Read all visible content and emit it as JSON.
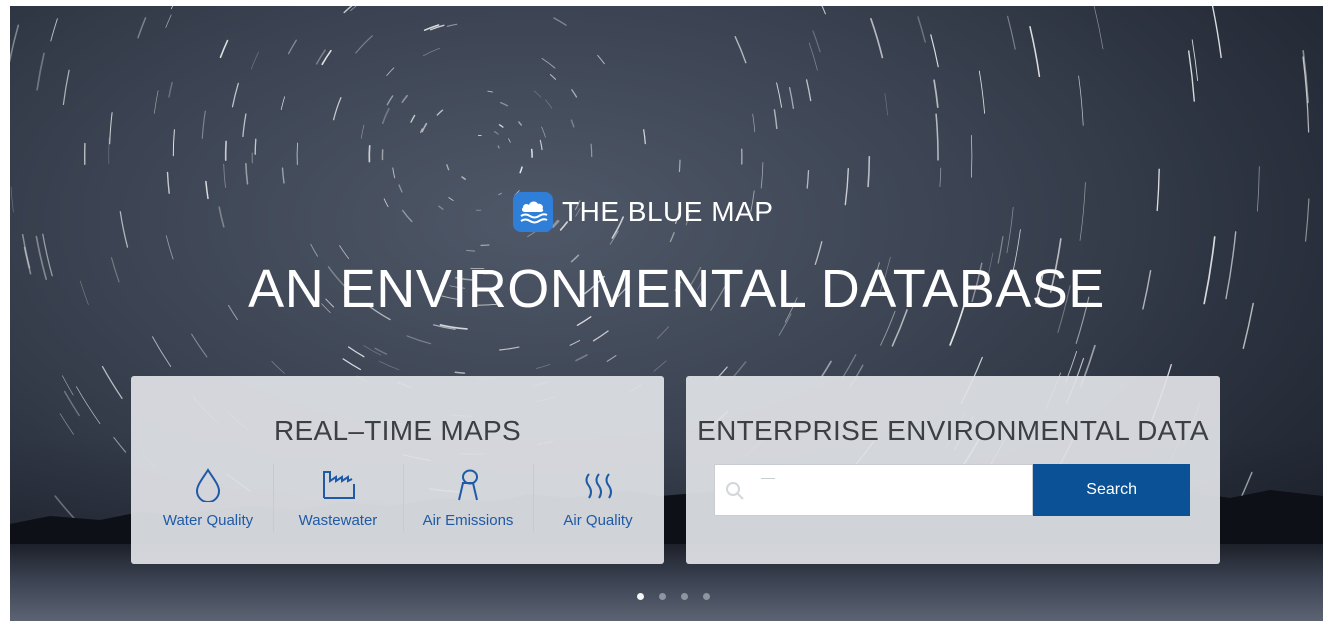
{
  "brand": {
    "name": "THE BLUE MAP",
    "logo_icon": "blue-map-cloud-icon",
    "logo_color": "#2f7fd8"
  },
  "headline": "AN ENVIRONMENTAL DATABASE",
  "realtime_maps": {
    "title": "REAL–TIME MAPS",
    "items": [
      {
        "label": "Water Quality",
        "icon": "water-drop-icon"
      },
      {
        "label": "Wastewater",
        "icon": "factory-icon"
      },
      {
        "label": "Air Emissions",
        "icon": "smokestack-icon"
      },
      {
        "label": "Air Quality",
        "icon": "air-waves-icon"
      }
    ],
    "accent_color": "#1f5aa6"
  },
  "enterprise": {
    "title": "ENTERPRISE ENVIRONMENTAL DATA",
    "search": {
      "placeholder": "",
      "value": "",
      "button_label": "Search",
      "button_color": "#0b5196"
    }
  },
  "carousel": {
    "slide_count": 4,
    "active_index": 0
  }
}
